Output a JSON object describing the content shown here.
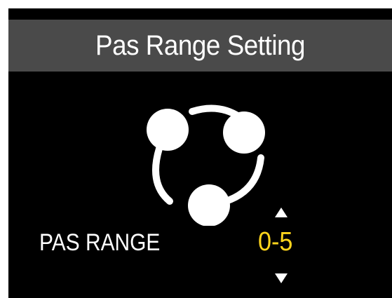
{
  "header": {
    "title": "Pas Range Setting"
  },
  "setting": {
    "label": "PAS RANGE",
    "value": "0-5"
  },
  "icons": {
    "main": "pas-range-icon",
    "increase": "arrow-up-icon",
    "decrease": "arrow-down-icon"
  },
  "colors": {
    "background": "#000000",
    "title_bar": "#4a4a4a",
    "text": "#ffffff",
    "value": "#ffd51c"
  }
}
